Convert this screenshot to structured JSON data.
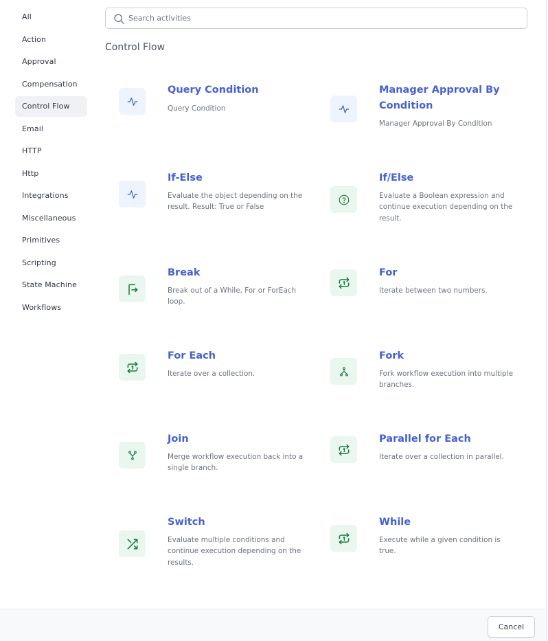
{
  "sidebar": {
    "items": [
      {
        "label": "All",
        "active": false
      },
      {
        "label": "Action",
        "active": false
      },
      {
        "label": "Approval",
        "active": false
      },
      {
        "label": "Compensation",
        "active": false
      },
      {
        "label": "Control Flow",
        "active": true
      },
      {
        "label": "Email",
        "active": false
      },
      {
        "label": "HTTP",
        "active": false
      },
      {
        "label": "Http",
        "active": false
      },
      {
        "label": "Integrations",
        "active": false
      },
      {
        "label": "Miscellaneous",
        "active": false
      },
      {
        "label": "Primitives",
        "active": false
      },
      {
        "label": "Scripting",
        "active": false
      },
      {
        "label": "State Machine",
        "active": false
      },
      {
        "label": "Workflows",
        "active": false
      }
    ]
  },
  "search": {
    "placeholder": "Search activities",
    "value": "",
    "icon": "search-icon"
  },
  "section": {
    "title": "Control Flow"
  },
  "activities": [
    {
      "title": "Query Condition",
      "description": "Query Condition",
      "icon": "activity-pulse-icon",
      "tint": "blue"
    },
    {
      "title": "Manager Approval By Condition",
      "description": "Manager Approval By Condition",
      "icon": "activity-pulse-icon",
      "tint": "blue"
    },
    {
      "title": "If-Else",
      "description": "Evaluate the object depending on the result. Result: True or False",
      "icon": "activity-pulse-icon",
      "tint": "blue"
    },
    {
      "title": "If/Else",
      "description": "Evaluate a Boolean expression and continue execution depending on the result.",
      "icon": "question-circle-icon",
      "tint": "green"
    },
    {
      "title": "Break",
      "description": "Break out of a While, For or ForEach loop.",
      "icon": "break-out-icon",
      "tint": "green"
    },
    {
      "title": "For",
      "description": "Iterate between two numbers.",
      "icon": "repeat-one-icon",
      "tint": "green"
    },
    {
      "title": "For Each",
      "description": "Iterate over a collection.",
      "icon": "repeat-one-icon",
      "tint": "green"
    },
    {
      "title": "Fork",
      "description": "Fork workflow execution into multiple branches.",
      "icon": "fork-icon",
      "tint": "green"
    },
    {
      "title": "Join",
      "description": "Merge workflow execution back into a single branch.",
      "icon": "merge-icon",
      "tint": "green"
    },
    {
      "title": "Parallel for Each",
      "description": "Iterate over a collection in parallel.",
      "icon": "repeat-one-icon",
      "tint": "green"
    },
    {
      "title": "Switch",
      "description": "Evaluate multiple conditions and continue execution depending on the results.",
      "icon": "shuffle-icon",
      "tint": "green"
    },
    {
      "title": "While",
      "description": "Execute while a given condition is true.",
      "icon": "repeat-one-icon",
      "tint": "green"
    }
  ],
  "footer": {
    "cancel_label": "Cancel"
  },
  "colors": {
    "accent": "#4661d2",
    "icon_blue": "#3b5bcc",
    "icon_green": "#157a3f",
    "active_bg": "#f0f1f4"
  }
}
